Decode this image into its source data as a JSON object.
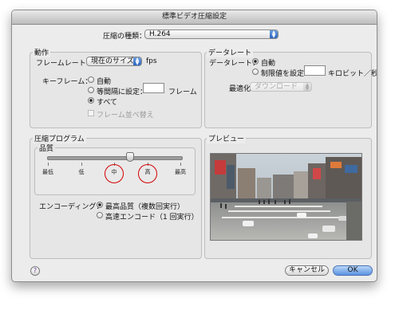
{
  "window": {
    "title": "標準ビデオ圧縮設定"
  },
  "compression_type": {
    "label": "圧縮の種類：",
    "value": "H.264"
  },
  "motion": {
    "legend": "動作",
    "frame_rate_label": "フレームレート：",
    "frame_rate_value": "現在のサイズ",
    "frame_rate_unit": "fps",
    "keyframe_label": "キーフレーム：",
    "keyframe_options": [
      "自動",
      "等間隔に設定：",
      "すべて"
    ],
    "keyframe_selected": "すべて",
    "keyframe_unit": "フレーム",
    "reorder_label": "フレーム並べ替え",
    "reorder_checked": false
  },
  "data_rate": {
    "legend": "データレート",
    "label": "データレート：",
    "options": [
      "自動",
      "制限値を設定："
    ],
    "selected": "自動",
    "unit": "キロビット／秒",
    "optimize_label": "最適化：",
    "optimize_value": "ダウンロード"
  },
  "compressor": {
    "legend": "圧縮プログラム",
    "quality_legend": "品質",
    "quality_ticks": [
      "最低",
      "低",
      "中",
      "高",
      "最高"
    ],
    "quality_level": 0.62,
    "highlighted": [
      "中",
      "高"
    ],
    "encoding_label": "エンコーディング：",
    "encoding_options": [
      "最高品質（複数回実行）",
      "高速エンコード（1 回実行）"
    ],
    "encoding_selected": "最高品質（複数回実行）"
  },
  "preview": {
    "legend": "プレビュー"
  },
  "buttons": {
    "help": "?",
    "cancel": "キャンセル",
    "ok": "OK"
  },
  "colors": {
    "accent": "#3b76d6",
    "highlight_circle": "#d40000"
  }
}
